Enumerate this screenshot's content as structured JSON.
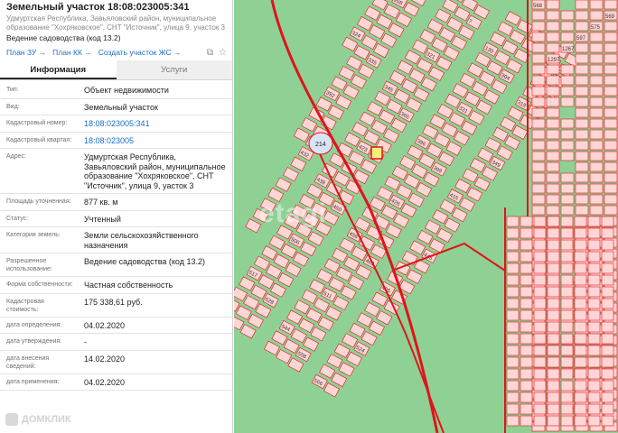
{
  "header": {
    "title": "Земельный участок 18:08:023005:341",
    "address_line1": "Удмуртская Республика, Завьяловский район, муниципальное",
    "address_line2": "образование \"Хохряковское\", СНТ \"Источник\", улица 9, участок 3",
    "purpose": "Ведение садоводства (код 13.2)"
  },
  "links": {
    "plan_zu": "План ЗУ →",
    "plan_kk": "План КК →",
    "create_zhs": "Создать участок ЖС →"
  },
  "tabs": {
    "info": "Информация",
    "services": "Услуги"
  },
  "fields": {
    "type_label": "Тип:",
    "type_value": "Объект недвижимости",
    "kind_label": "Вид:",
    "kind_value": "Земельный участок",
    "cad_num_label": "Кадастровый номер:",
    "cad_num_value": "18:08:023005:341",
    "cad_quarter_label": "Кадастровый квартал:",
    "cad_quarter_value": "18:08:023005",
    "address_label": "Адрес:",
    "address_value": "Удмуртская Республика, Завьяловский район, муниципальное образование \"Хохряковское\", СНТ \"Источник\", улица 9, уасток 3",
    "area_label": "Площадь уточненная:",
    "area_value": "877 кв. м",
    "status_label": "Статус:",
    "status_value": "Учтенный",
    "category_label": "Категория земель:",
    "category_value": "Земли сельскохозяйственного назначения",
    "permitted_label": "Разрешенное использование:",
    "permitted_value": "Ведение садоводства (код 13.2)",
    "ownership_label": "Форма собственности:",
    "ownership_value": "Частная собственность",
    "cost_label": "Кадастровая стоимость:",
    "cost_value": "175 338,61 руб.",
    "def_date_label": "дата определения:",
    "def_date_value": "04.02.2020",
    "approval_label": "дата утверждения:",
    "approval_value": "-",
    "entry_label": "дата внесения сведений:",
    "entry_value": "14.02.2020",
    "apply_label": "дата применения:",
    "apply_value": "04.02.2020"
  },
  "branding": {
    "domclick": "ДОМКЛИК",
    "etagi": "etagi"
  },
  "map": {
    "lake_label": "214",
    "plot_labels": [
      "1",
      "3",
      "7",
      "130",
      "268",
      "304",
      "319",
      "321",
      "324",
      "331",
      "335",
      "345",
      "349",
      "365",
      "386",
      "392",
      "399",
      "415",
      "423",
      "426",
      "432",
      "438",
      "445",
      "450",
      "456",
      "469",
      "495",
      "506",
      "511",
      "517",
      "524",
      "528",
      "544",
      "558",
      "566",
      "568",
      "569",
      "575",
      "597",
      "1267",
      "1297"
    ],
    "colors": {
      "land": "#8fd195",
      "plot": "#ffd6d6",
      "boundary": "#e0141a",
      "water": "#d8e4f4",
      "selected": "#f4f07a"
    }
  },
  "icons": [
    "copy-icon",
    "star-icon",
    "domclick-logo-icon"
  ]
}
